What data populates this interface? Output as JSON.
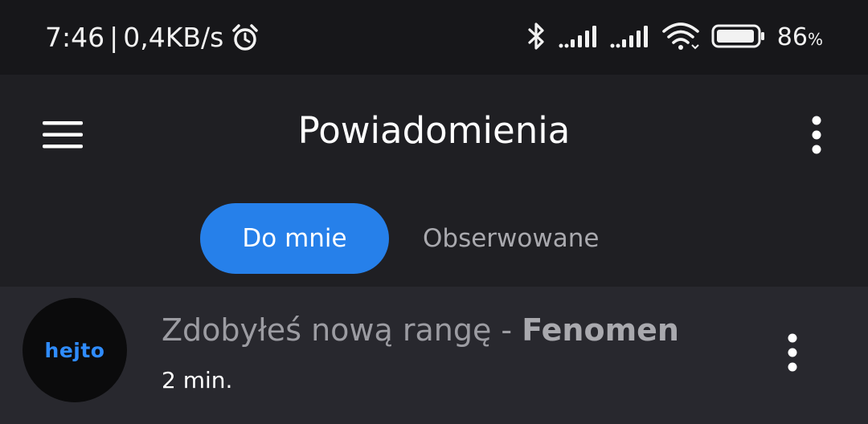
{
  "status_bar": {
    "time": "7:46",
    "separator": "|",
    "network_speed": "0,4KB/s",
    "battery_percent": "86",
    "battery_unit": "%"
  },
  "app_bar": {
    "title": "Powiadomienia",
    "menu_icon": "hamburger-icon",
    "more_icon": "more-vertical-icon"
  },
  "tabs": [
    {
      "label": "Do mnie",
      "active": true
    },
    {
      "label": "Obserwowane",
      "active": false
    }
  ],
  "notifications": [
    {
      "avatar_text": "hejto",
      "text_prefix": "Zdobyłeś nową rangę - ",
      "text_bold": "Fenomen",
      "time": "2 min."
    }
  ],
  "colors": {
    "accent": "#2680ea",
    "background": "#1f1f23",
    "status_bar": "#17171a",
    "row_background": "#28282e"
  }
}
